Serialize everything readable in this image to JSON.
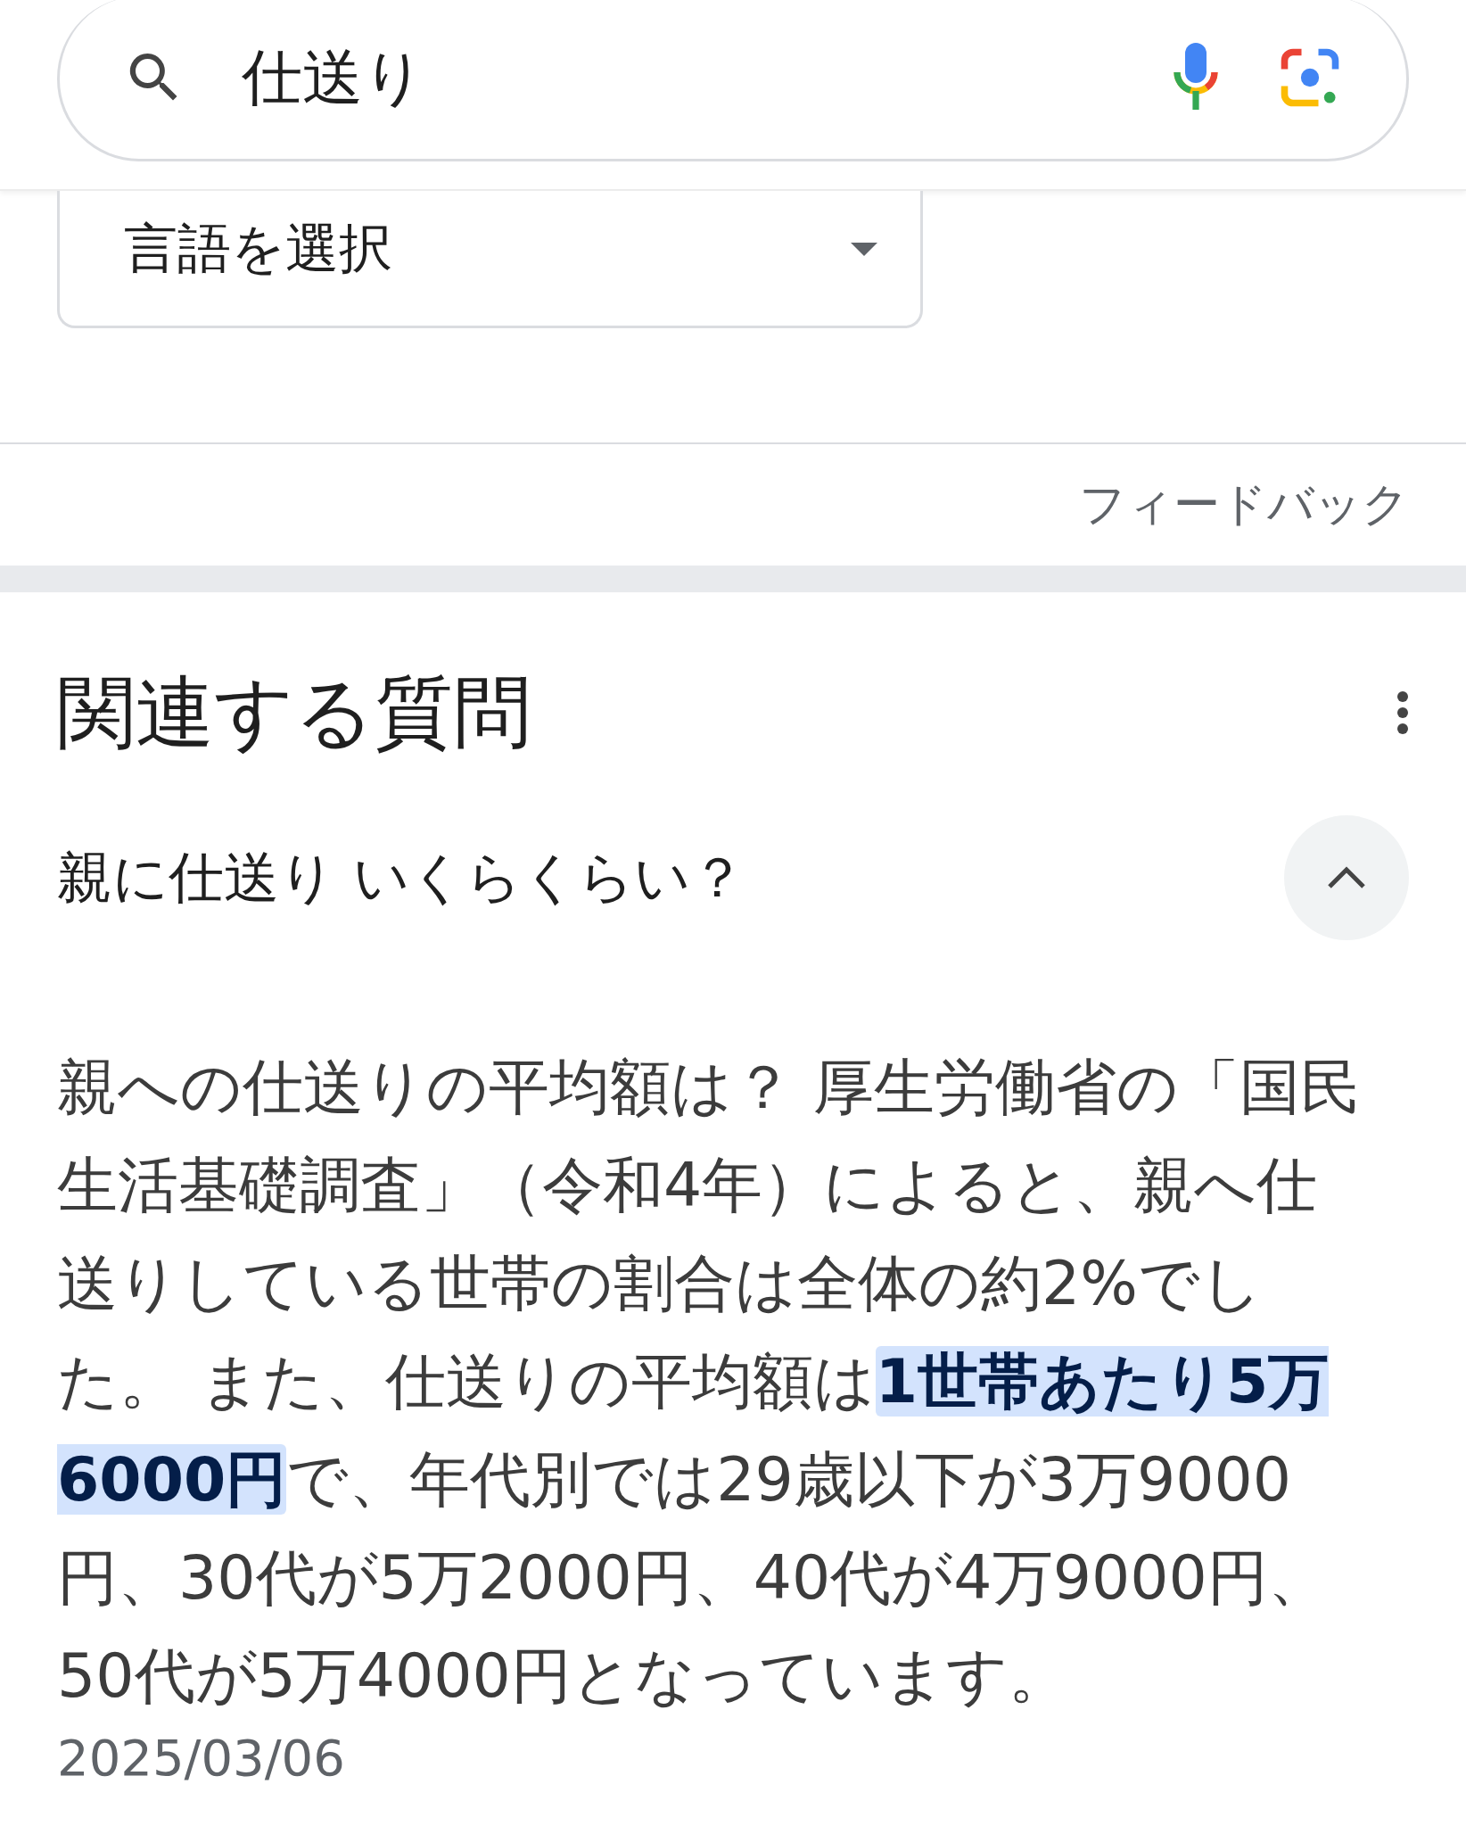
{
  "search": {
    "value": "仕送り"
  },
  "language_select": {
    "label": "言語を選択"
  },
  "feedback": "フィードバック",
  "related_questions": {
    "title": "関連する質問",
    "items": [
      {
        "question": "親に仕送り いくらくらい？",
        "expanded": true,
        "answer": "親への仕送りの平均額は？ 厚生労働省の「国民生活基礎調査」（令和4年）によると、親へ仕送りしている世帯の割合は全体の約2%でした。 また、仕送りの平均額は**1世帯あたり5万6000円**で、年代別では29歳以下が3万9000円、30代が5万2000円、40代が4万9000円、50代が5万4000円となっています。",
        "date": "2025/03/06"
      }
    ]
  }
}
